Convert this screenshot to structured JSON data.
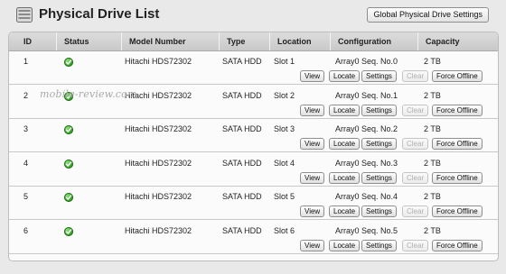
{
  "page": {
    "title": "Physical Drive List",
    "global_button_label": "Global Physical Drive Settings",
    "watermark": "mobile-review.com"
  },
  "table": {
    "columns": [
      "ID",
      "Status",
      "Model Number",
      "Type",
      "Location",
      "Configuration",
      "Capacity"
    ],
    "action_labels": {
      "view": "View",
      "locate": "Locate",
      "settings": "Settings",
      "clear": "Clear",
      "force_offline": "Force Offline"
    },
    "rows": [
      {
        "id": "1",
        "status": "ok",
        "model": "Hitachi HDS72302",
        "type": "SATA HDD",
        "location": "Slot 1",
        "configuration": "Array0 Seq. No.0",
        "capacity": "2 TB"
      },
      {
        "id": "2",
        "status": "ok",
        "model": "Hitachi HDS72302",
        "type": "SATA HDD",
        "location": "Slot 2",
        "configuration": "Array0 Seq. No.1",
        "capacity": "2 TB"
      },
      {
        "id": "3",
        "status": "ok",
        "model": "Hitachi HDS72302",
        "type": "SATA HDD",
        "location": "Slot 3",
        "configuration": "Array0 Seq. No.2",
        "capacity": "2 TB"
      },
      {
        "id": "4",
        "status": "ok",
        "model": "Hitachi HDS72302",
        "type": "SATA HDD",
        "location": "Slot 4",
        "configuration": "Array0 Seq. No.3",
        "capacity": "2 TB"
      },
      {
        "id": "5",
        "status": "ok",
        "model": "Hitachi HDS72302",
        "type": "SATA HDD",
        "location": "Slot 5",
        "configuration": "Array0 Seq. No.4",
        "capacity": "2 TB"
      },
      {
        "id": "6",
        "status": "ok",
        "model": "Hitachi HDS72302",
        "type": "SATA HDD",
        "location": "Slot 6",
        "configuration": "Array0 Seq. No.5",
        "capacity": "2 TB"
      }
    ]
  },
  "icons": {
    "title_icon": "hard-drive-icon",
    "status_icon": "status-ok-check-icon"
  },
  "colors": {
    "status_ok": "#2f9a22",
    "header_bg": "#d2d2d2",
    "page_bg": "#e9e9e9"
  }
}
